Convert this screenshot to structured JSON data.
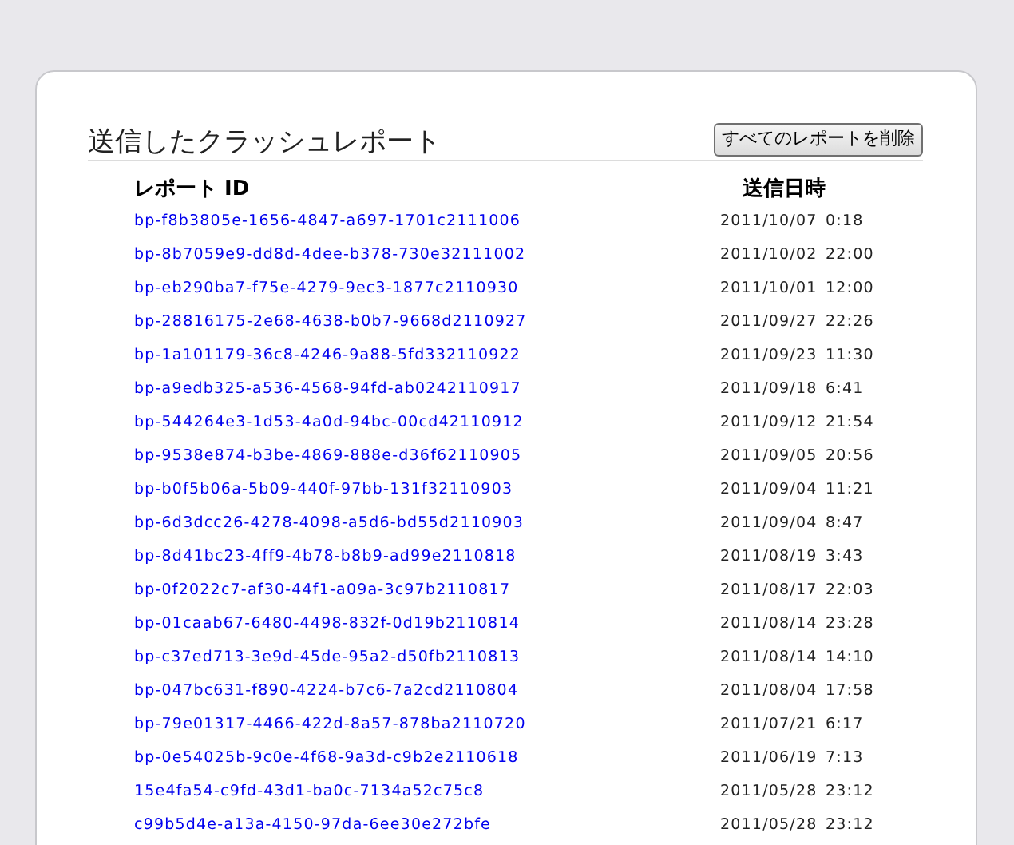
{
  "title": "送信したクラッシュレポート",
  "delete_all_button": "すべてのレポートを削除",
  "table": {
    "columns": [
      "レポート ID",
      "送信日時"
    ],
    "rows": [
      {
        "id": "bp-f8b3805e-1656-4847-a697-1701c2111006",
        "date": "2011/10/07",
        "time": "0:18"
      },
      {
        "id": "bp-8b7059e9-dd8d-4dee-b378-730e32111002",
        "date": "2011/10/02",
        "time": "22:00"
      },
      {
        "id": "bp-eb290ba7-f75e-4279-9ec3-1877c2110930",
        "date": "2011/10/01",
        "time": "12:00"
      },
      {
        "id": "bp-28816175-2e68-4638-b0b7-9668d2110927",
        "date": "2011/09/27",
        "time": "22:26"
      },
      {
        "id": "bp-1a101179-36c8-4246-9a88-5fd332110922",
        "date": "2011/09/23",
        "time": "11:30"
      },
      {
        "id": "bp-a9edb325-a536-4568-94fd-ab0242110917",
        "date": "2011/09/18",
        "time": "6:41"
      },
      {
        "id": "bp-544264e3-1d53-4a0d-94bc-00cd42110912",
        "date": "2011/09/12",
        "time": "21:54"
      },
      {
        "id": "bp-9538e874-b3be-4869-888e-d36f62110905",
        "date": "2011/09/05",
        "time": "20:56"
      },
      {
        "id": "bp-b0f5b06a-5b09-440f-97bb-131f32110903",
        "date": "2011/09/04",
        "time": "11:21"
      },
      {
        "id": "bp-6d3dcc26-4278-4098-a5d6-bd55d2110903",
        "date": "2011/09/04",
        "time": "8:47"
      },
      {
        "id": "bp-8d41bc23-4ff9-4b78-b8b9-ad99e2110818",
        "date": "2011/08/19",
        "time": "3:43"
      },
      {
        "id": "bp-0f2022c7-af30-44f1-a09a-3c97b2110817",
        "date": "2011/08/17",
        "time": "22:03"
      },
      {
        "id": "bp-01caab67-6480-4498-832f-0d19b2110814",
        "date": "2011/08/14",
        "time": "23:28"
      },
      {
        "id": "bp-c37ed713-3e9d-45de-95a2-d50fb2110813",
        "date": "2011/08/14",
        "time": "14:10"
      },
      {
        "id": "bp-047bc631-f890-4224-b7c6-7a2cd2110804",
        "date": "2011/08/04",
        "time": "17:58"
      },
      {
        "id": "bp-79e01317-4466-422d-8a57-878ba2110720",
        "date": "2011/07/21",
        "time": "6:17"
      },
      {
        "id": "bp-0e54025b-9c0e-4f68-9a3d-c9b2e2110618",
        "date": "2011/06/19",
        "time": "7:13"
      },
      {
        "id": "15e4fa54-c9fd-43d1-ba0c-7134a52c75c8",
        "date": "2011/05/28",
        "time": "23:12"
      },
      {
        "id": "c99b5d4e-a13a-4150-97da-6ee30e272bfe",
        "date": "2011/05/28",
        "time": "23:12"
      }
    ]
  }
}
